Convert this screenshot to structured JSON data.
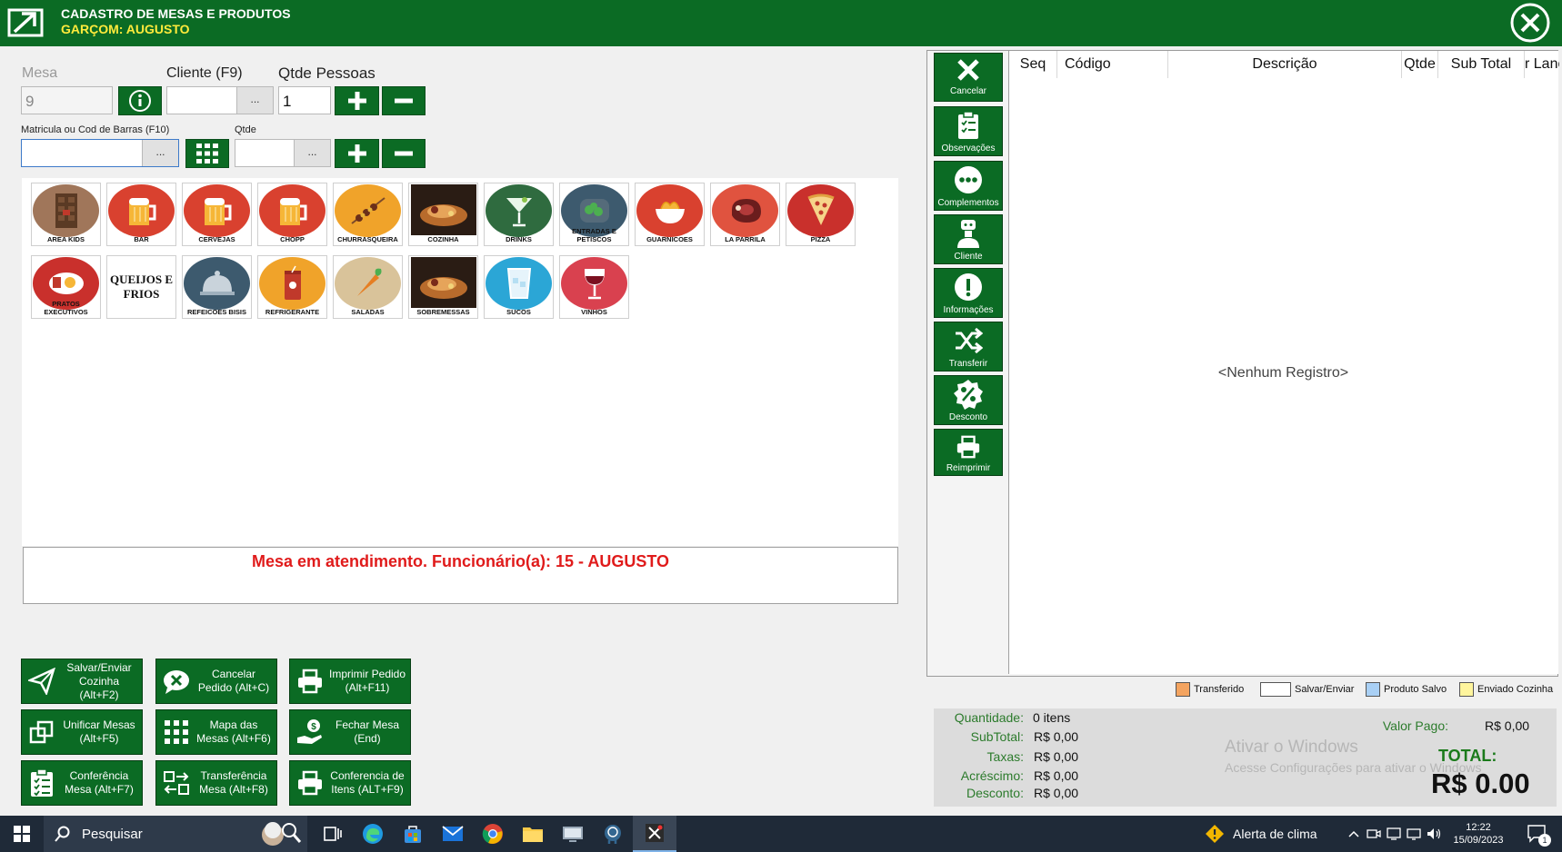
{
  "window": {
    "title": "CADASTRO DE MESAS E PRODUTOS",
    "subtitle": "GARÇOM: AUGUSTO"
  },
  "form": {
    "mesa_label": "Mesa",
    "mesa_value": "9",
    "cliente_label": "Cliente (F9)",
    "cliente_value": "",
    "pessoas_label": "Qtde Pessoas",
    "pessoas_value": "1",
    "matricula_label": "Matricula ou Cod de Barras (F10)",
    "matricula_value": "",
    "qtde_label": "Qtde",
    "qtde_value": "",
    "dots": "..."
  },
  "categories": [
    {
      "name": "AREA KIDS",
      "color": "#a0765a"
    },
    {
      "name": "BAR",
      "color": "#d9412f"
    },
    {
      "name": "CERVEJAS",
      "color": "#d9412f"
    },
    {
      "name": "CHOPP",
      "color": "#d9412f"
    },
    {
      "name": "CHURRASQUEIRA",
      "color": "#f0a32a"
    },
    {
      "name": "COZINHA",
      "color": "#3a2a1e"
    },
    {
      "name": "DRINKS",
      "color": "#2f6b3f"
    },
    {
      "name": "ENTRADAS E PETISCOS",
      "color": "#3d5a6e"
    },
    {
      "name": "GUARNICOES",
      "color": "#d9412f"
    },
    {
      "name": "LA PARRILA",
      "color": "#e0533f"
    },
    {
      "name": "PIZZA",
      "color": "#c9302c"
    },
    {
      "name": "PRATOS EXECUTIVOS",
      "color": "#c9302c"
    },
    {
      "name": "QUEIJOS E FRIOS",
      "color": "#ffffff"
    },
    {
      "name": "REFEICOES BISIS",
      "color": "#3d5a6e"
    },
    {
      "name": "REFRIGERANTE",
      "color": "#f0a32a"
    },
    {
      "name": "SALADAS",
      "color": "#d9c39a"
    },
    {
      "name": "SOBREMESSAS",
      "color": "#3a2a1e"
    },
    {
      "name": "SUCOS",
      "color": "#2ba6d6"
    },
    {
      "name": "VINHOS",
      "color": "#d9414f"
    }
  ],
  "status_message": "Mesa em atendimento. Funcionário(a): 15 - AUGUSTO",
  "actions": {
    "salvar": "Salvar/Enviar Cozinha (Alt+F2)",
    "cancelar_pedido": "Cancelar Pedido (Alt+C)",
    "imprimir": "Imprimir Pedido (Alt+F11)",
    "unificar": "Unificar Mesas (Alt+F5)",
    "mapa": "Mapa das Mesas (Alt+F6)",
    "fechar": "Fechar Mesa (End)",
    "conferencia_mesa": "Conferência Mesa (Alt+F7)",
    "transferencia": "Transferência Mesa (Alt+F8)",
    "conferencia_itens": "Conferencia de Itens (ALT+F9)"
  },
  "sidebar": {
    "cancelar": "Cancelar",
    "observacoes": "Observações",
    "complementos": "Complementos",
    "cliente": "Cliente",
    "informacoes": "Informações",
    "transferir": "Transferir",
    "desconto": "Desconto",
    "reimprimir": "Reimprimir"
  },
  "grid": {
    "columns": [
      "Seq",
      "Código",
      "Descrição",
      "Qtde",
      "Sub Total",
      "r Lançamen"
    ],
    "empty_text": "<Nenhum Registro>"
  },
  "legend": {
    "transferido": "Transferido",
    "salvar_enviar": "Salvar/Enviar",
    "produto_salvo": "Produto Salvo",
    "enviado_cozinha": "Enviado Cozinha",
    "colors": {
      "transferido": "#f4a460",
      "salvar_enviar": "#ffffff",
      "produto_salvo": "#a9d0f5",
      "enviado_cozinha": "#fff59d"
    }
  },
  "totals": {
    "quantidade_label": "Quantidade:",
    "quantidade_value": "0 itens",
    "subtotal_label": "SubTotal:",
    "subtotal_value": "R$ 0,00",
    "taxas_label": "Taxas:",
    "taxas_value": "R$ 0,00",
    "acrescimo_label": "Acréscimo:",
    "acrescimo_value": "R$ 0,00",
    "desconto_label": "Desconto:",
    "desconto_value": "R$ 0,00",
    "valor_pago_label": "Valor Pago:",
    "valor_pago_value": "R$ 0,00",
    "total_label": "TOTAL:",
    "total_value": "R$ 0.00"
  },
  "watermark": {
    "line1": "Ativar o Windows",
    "line2": "Acesse Configurações para ativar o Windows"
  },
  "taskbar": {
    "search": "Pesquisar",
    "weather": "Alerta de clima",
    "time": "12:22",
    "date": "15/09/2023",
    "notifications": "1"
  }
}
